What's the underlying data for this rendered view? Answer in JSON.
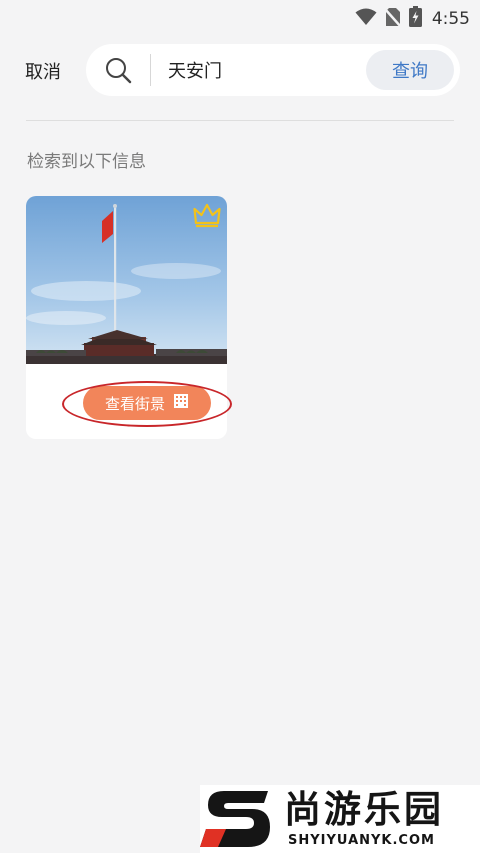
{
  "status_bar": {
    "time": "4:55",
    "icons": [
      "wifi-icon",
      "no-sim-icon",
      "battery-charging-icon"
    ]
  },
  "search": {
    "cancel_label": "取消",
    "query": "天安门",
    "placeholder": "",
    "submit_label": "查询"
  },
  "results": {
    "heading": "检索到以下信息",
    "items": [
      {
        "button_label": "查看街景",
        "badge": "crown-icon"
      }
    ]
  },
  "watermark": {
    "brand_cn": "尚游乐园",
    "brand_en": "SHYIYUANYK.COM"
  },
  "colors": {
    "background": "#f4f4f5",
    "accent_blue": "#3e78c6",
    "button_orange": "#f2855a",
    "highlight_red": "#c8262a",
    "crown_gold": "#f2c21b"
  }
}
